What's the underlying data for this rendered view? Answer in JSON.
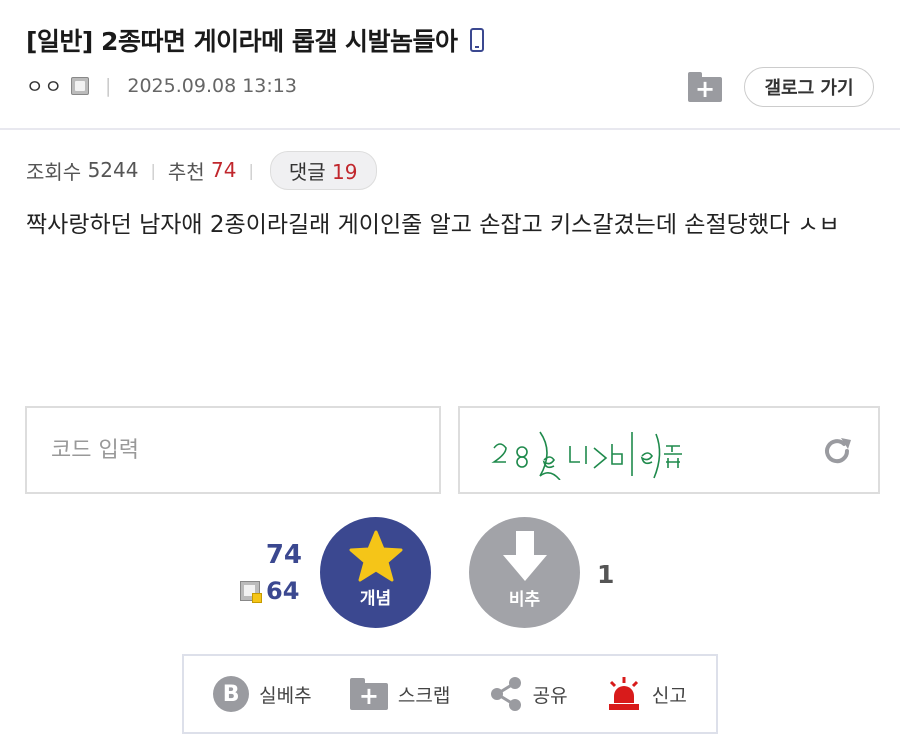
{
  "post": {
    "title": "[일반] 2종따면 게이라메 롭갤 시발놈들아",
    "author": "ㅇㅇ",
    "date": "2025.09.08 13:13",
    "views_label": "조회수",
    "views": "5244",
    "recommend_label": "추천",
    "recommend": "74",
    "comments_label": "댓글",
    "comments": "19",
    "body": "짝사랑하던 남자애 2종이라길래 게이인줄 알고 손잡고 키스갈겼는데 손절당했다 ㅅㅂ"
  },
  "header": {
    "gallog_button": "갤로그 가기"
  },
  "captcha": {
    "placeholder": "코드 입력"
  },
  "vote": {
    "up_count": "74",
    "fix_count": "64",
    "up_label": "개념",
    "down_label": "비추",
    "down_count": "1"
  },
  "actions": {
    "silbe_label": "실베추",
    "scrap_label": "스크랩",
    "share_label": "공유",
    "report_label": "신고"
  },
  "colors": {
    "accent": "#3b4890",
    "red": "#c1272d",
    "gray_button": "#a2a3a8"
  }
}
